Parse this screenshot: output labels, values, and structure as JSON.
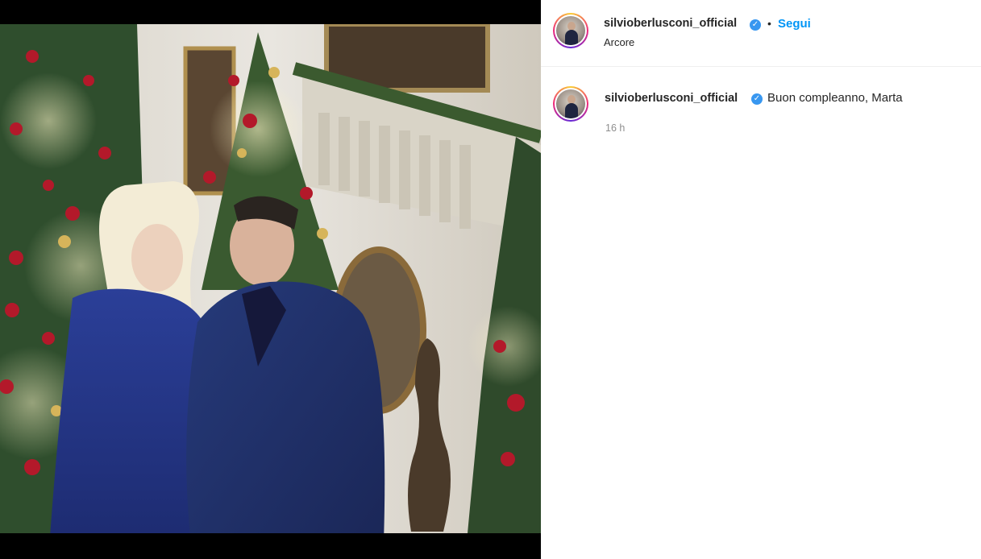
{
  "post": {
    "image_alt": "Photo of a couple in front of Christmas trees",
    "author": {
      "username": "silvioberlusconi_official",
      "verified_icon": "verified-badge-icon",
      "location": "Arcore"
    },
    "header": {
      "separator": "•",
      "follow_label": "Segui"
    },
    "caption": {
      "username": "silvioberlusconi_official",
      "text": "Buon compleanno, Marta",
      "time": "16 h"
    }
  },
  "colors": {
    "link_blue": "#0095f6",
    "verified_blue": "#3897f0",
    "muted_text": "#8e8e8e"
  }
}
